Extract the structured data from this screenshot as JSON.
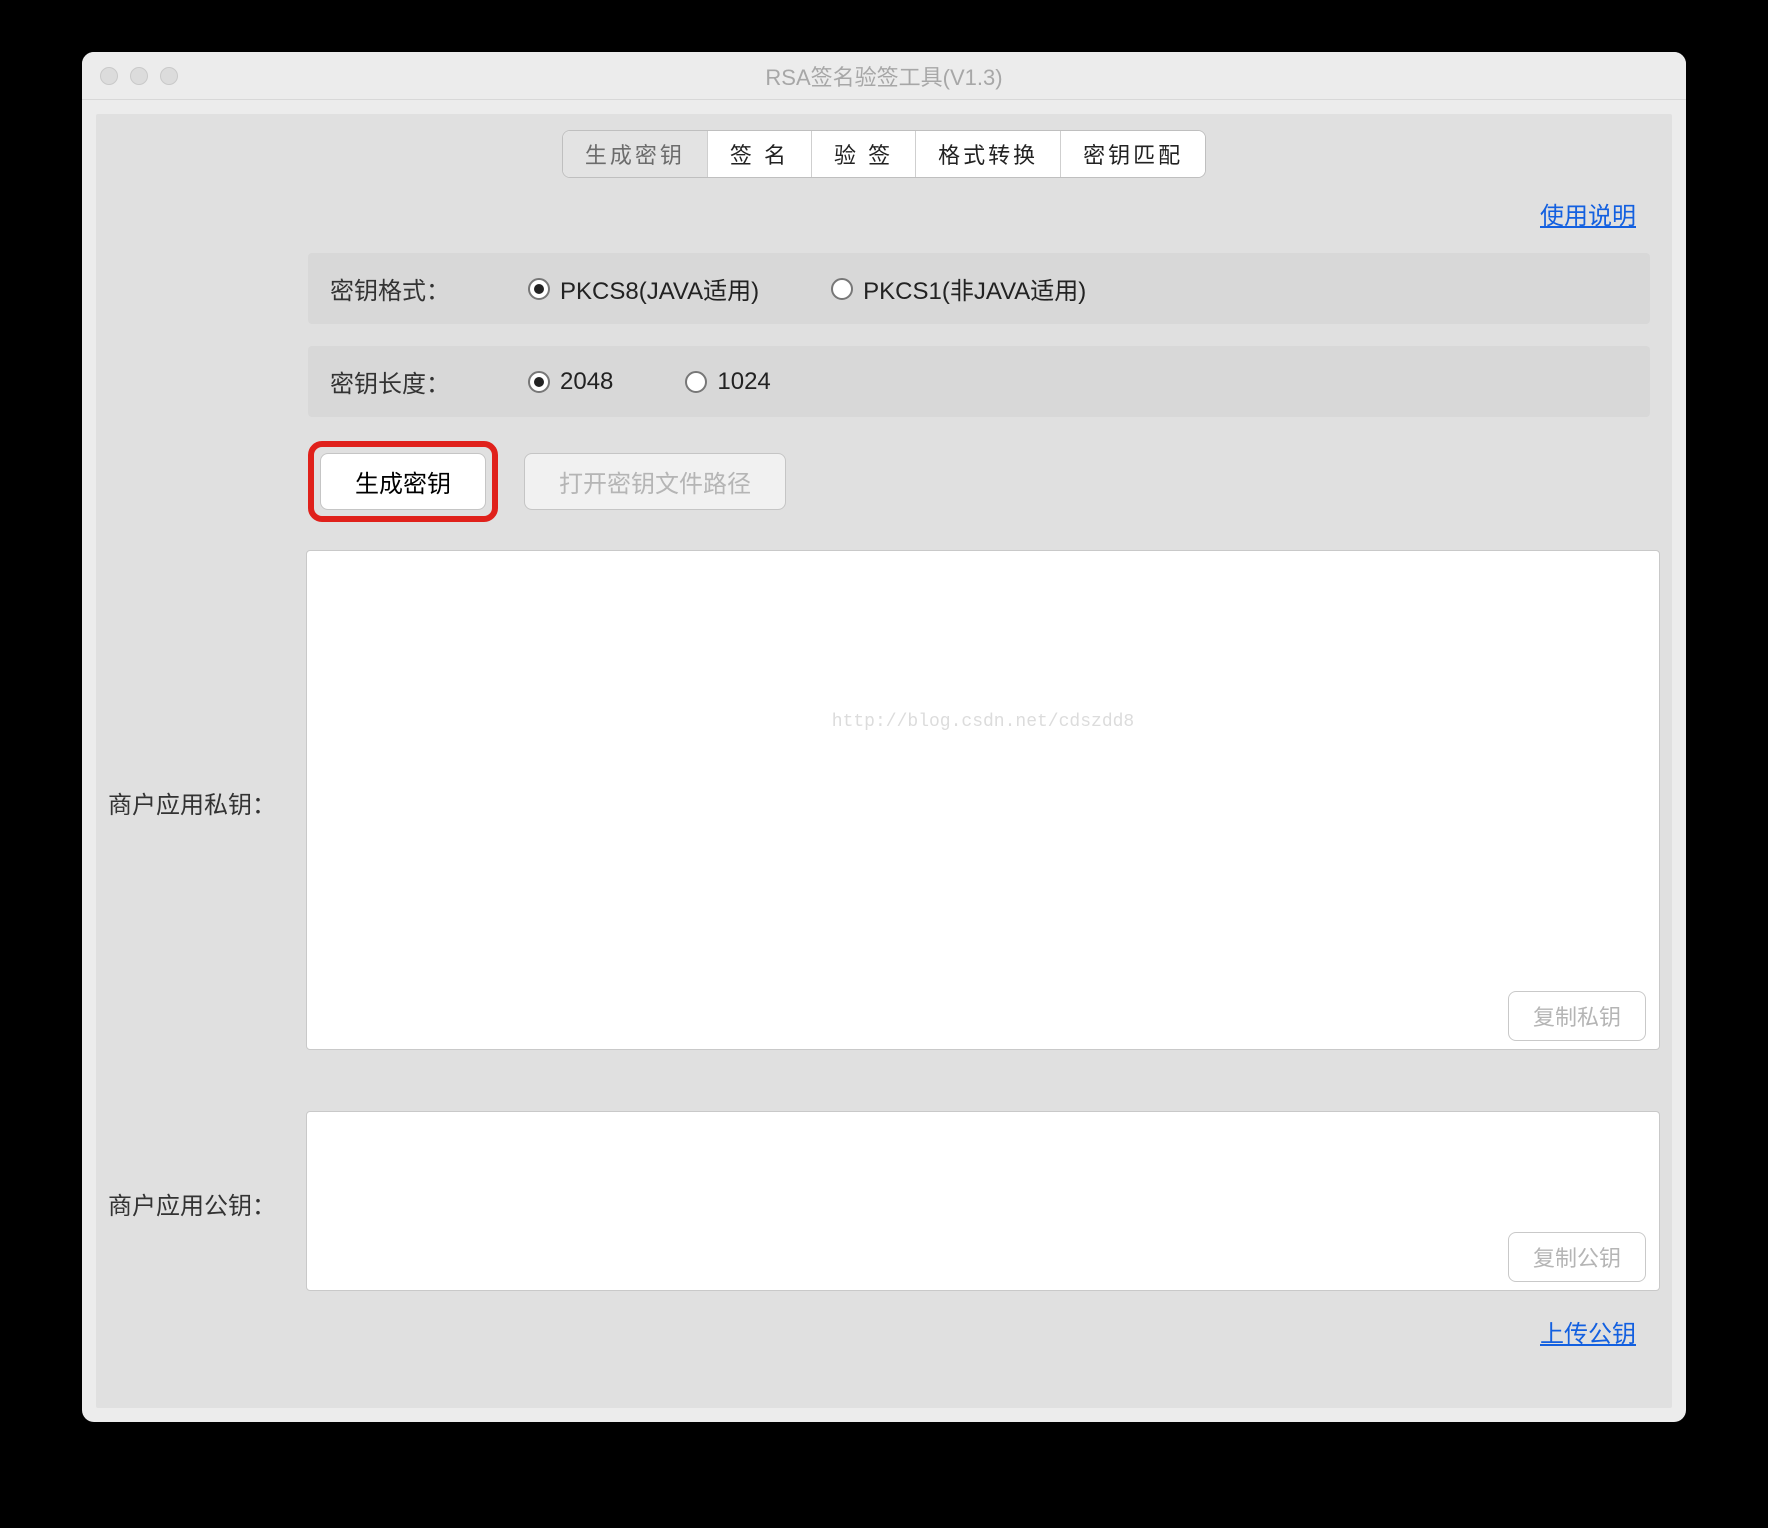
{
  "window": {
    "title": "RSA签名验签工具(V1.3)"
  },
  "tabs": [
    {
      "label": "生成密钥",
      "active": true
    },
    {
      "label": "签 名",
      "active": false
    },
    {
      "label": "验 签",
      "active": false
    },
    {
      "label": "格式转换",
      "active": false
    },
    {
      "label": "密钥匹配",
      "active": false
    }
  ],
  "links": {
    "help": "使用说明",
    "upload": "上传公钥"
  },
  "format_row": {
    "label": "密钥格式：",
    "options": [
      {
        "label": "PKCS8(JAVA适用)",
        "checked": true
      },
      {
        "label": "PKCS1(非JAVA适用)",
        "checked": false
      }
    ]
  },
  "length_row": {
    "label": "密钥长度：",
    "options": [
      {
        "label": "2048",
        "checked": true
      },
      {
        "label": "1024",
        "checked": false
      }
    ]
  },
  "buttons": {
    "generate": "生成密钥",
    "open_path": "打开密钥文件路径",
    "copy_private": "复制私钥",
    "copy_public": "复制公钥"
  },
  "fields": {
    "private_label": "商户应用私钥：",
    "private_value": "",
    "public_label": "商户应用公钥：",
    "public_value": ""
  },
  "watermark": "http://blog.csdn.net/cdszdd8"
}
